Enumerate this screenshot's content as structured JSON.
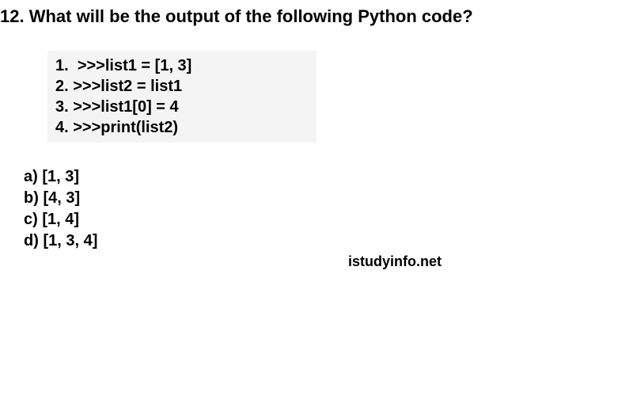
{
  "question": {
    "number": "12.",
    "text": "What will be the output of the following Python code?"
  },
  "code": {
    "lines": [
      {
        "n": "1.",
        "content": ">>>list1 = [1, 3]"
      },
      {
        "n": "2.",
        "content": ">>>list2 = list1"
      },
      {
        "n": "3.",
        "content": ">>>list1[0] = 4"
      },
      {
        "n": "4.",
        "content": ">>>print(list2)"
      }
    ]
  },
  "options": [
    {
      "label": "a)",
      "text": "[1, 3]"
    },
    {
      "label": "b)",
      "text": "[4, 3]"
    },
    {
      "label": "c)",
      "text": "[1, 4]"
    },
    {
      "label": "d)",
      "text": "[1, 3, 4]"
    }
  ],
  "watermark": "istudyinfo.net"
}
